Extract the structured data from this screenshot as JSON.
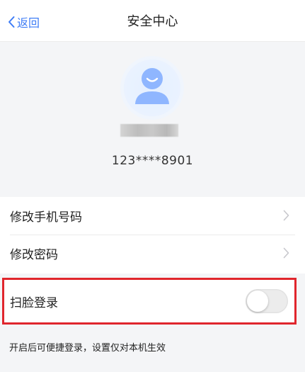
{
  "nav": {
    "back_label": "返回",
    "title": "安全中心"
  },
  "profile": {
    "phone": "123****8901"
  },
  "menu": {
    "items": [
      {
        "label": "修改手机号码"
      },
      {
        "label": "修改密码"
      }
    ]
  },
  "face_login": {
    "label": "扫脸登录",
    "enabled": false,
    "hint": "开启后可便捷登录，设置仅对本机生效"
  },
  "colors": {
    "accent": "#3f7df6",
    "highlight_border": "#e0262d",
    "avatar": "#8fb6ff"
  }
}
